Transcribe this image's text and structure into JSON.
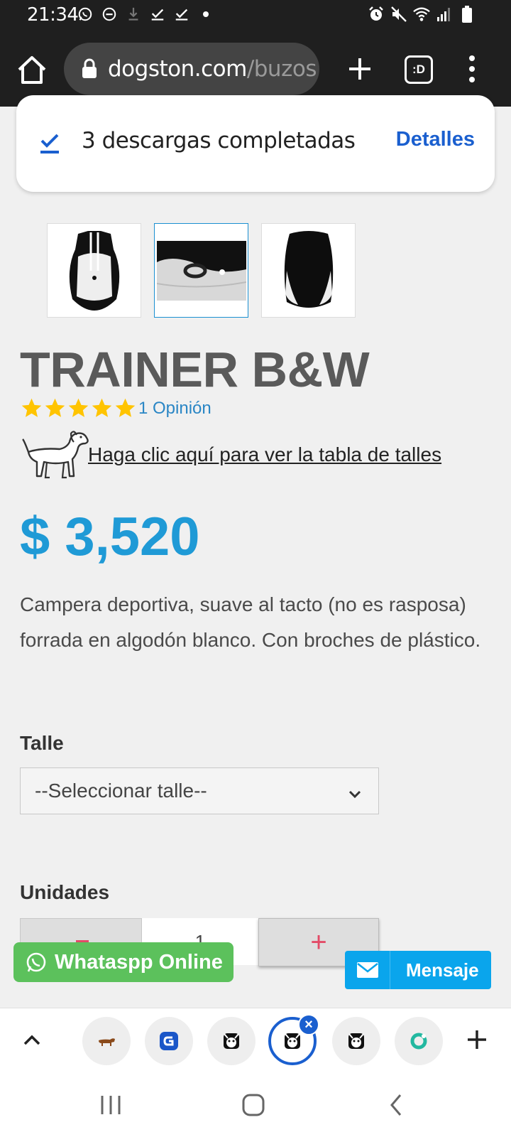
{
  "status_bar": {
    "time": "21:34",
    "left_icons": [
      "whatsapp-icon",
      "dnd-icon",
      "download-icon",
      "check-icon",
      "check-icon",
      "dot-icon"
    ],
    "right_icons": [
      "alarm-icon",
      "mute-icon",
      "wifi-icon",
      "signal-icon",
      "battery-icon"
    ]
  },
  "browser": {
    "url_domain": "dogston.com",
    "url_path": "/buzos",
    "tabs_label": ":D"
  },
  "download_toast": {
    "message": "3 descargas completadas",
    "action": "Detalles"
  },
  "product": {
    "thumbnails": [
      "front",
      "detail",
      "back"
    ],
    "active_thumbnail": 1,
    "title": "TRAINER B&W",
    "stars": 5,
    "reviews": "1 Opinión",
    "size_guide_link": "Haga clic aquí para ver la tabla de talles",
    "price": "$ 3,520",
    "description": "Campera deportiva, suave al tacto (no es rasposa) forrada en algodón blanco. Con broches de plástico.",
    "size_label": "Talle",
    "size_select": "--Seleccionar talle--",
    "units_label": "Unidades",
    "quantity": "1",
    "plus": "+"
  },
  "chat": {
    "whatsapp": "Whataspp Online",
    "mensaje": "Mensaje"
  },
  "colors": {
    "price": "#1f9ad6",
    "accent_blue": "#1a5fcf",
    "whatsapp_green": "#5cc15c",
    "mensaje_blue": "#0aa5ec",
    "stepper_red": "#e34b67",
    "star_yellow": "#ffc400"
  }
}
